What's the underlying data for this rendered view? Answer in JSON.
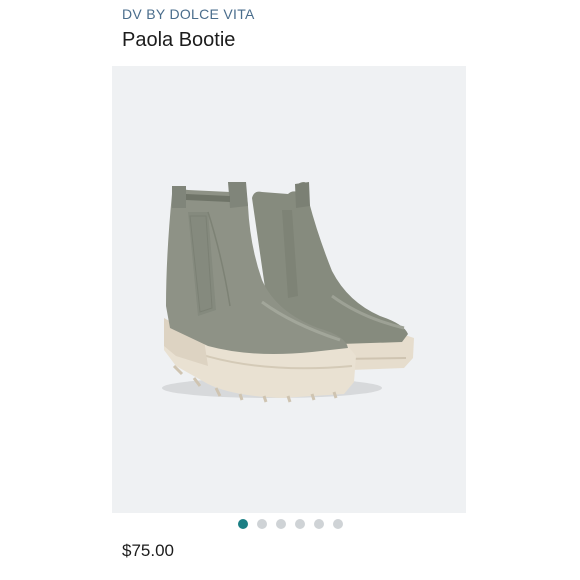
{
  "product": {
    "brand": "DV BY DOLCE VITA",
    "name": "Paola Bootie",
    "price": "$75.00"
  },
  "gallery": {
    "image_description": "Pair of sage-green Chelsea boots with cream lug soles",
    "slide_count": 6,
    "active_slide": 1,
    "colors": {
      "background": "#eff1f3",
      "upper": "#8b8f82",
      "sole": "#e6ddcd",
      "dot_active": "#1b7f84",
      "dot_inactive": "#cfd3d6"
    }
  },
  "colors": {
    "brand_text": "#4a6d8c",
    "text": "#1c1c1c"
  }
}
